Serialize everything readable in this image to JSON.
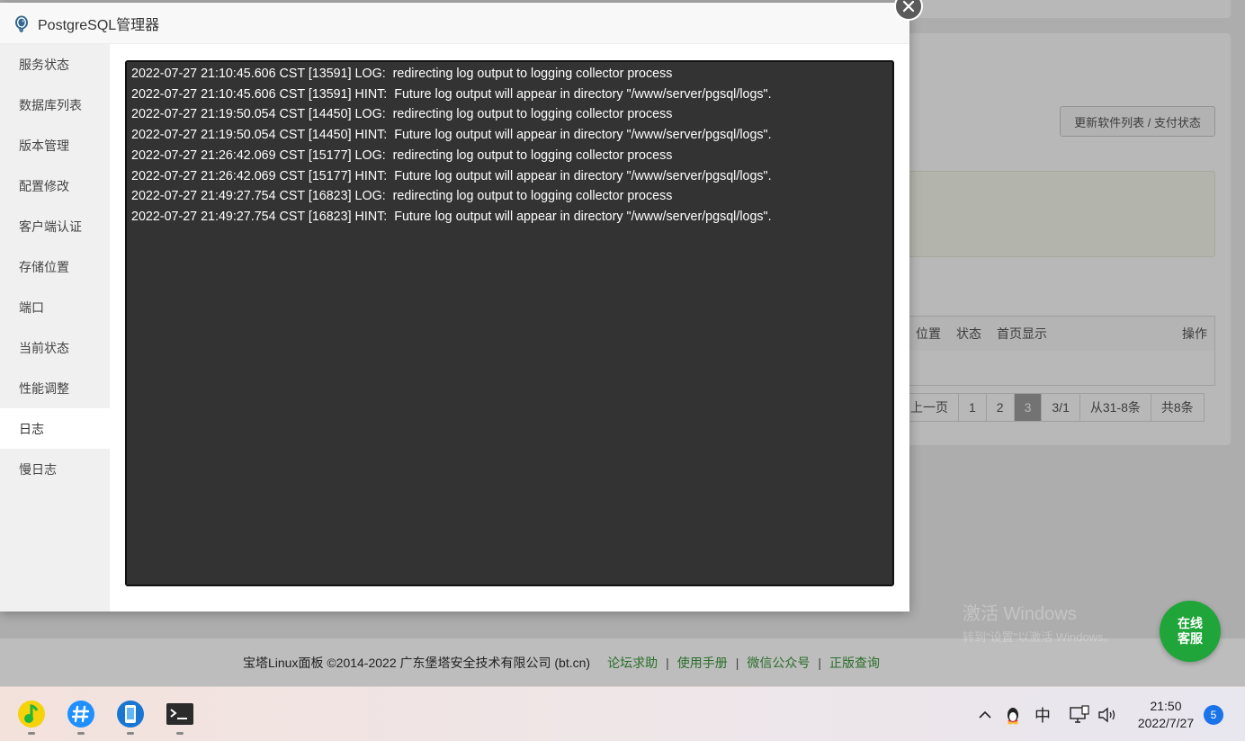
{
  "background": {
    "update_button": "更新软件列表 / 支付状态",
    "table_headers": [
      "位置",
      "状态",
      "首页显示"
    ],
    "table_ops": "操作",
    "pager": [
      "上一页",
      "1",
      "2",
      "3",
      "3/1",
      "从31-8条",
      "共8条"
    ],
    "pager_active_index": 3
  },
  "footer": {
    "copyright": "宝塔Linux面板 ©2014-2022 广东堡塔安全技术有限公司 (bt.cn)",
    "links": [
      "论坛求助",
      "使用手册",
      "微信公众号",
      "正版查询"
    ],
    "separator": "|"
  },
  "watermark": {
    "line1": "激活 Windows",
    "line2": "转到\"设置\"以激活 Windows。"
  },
  "support": {
    "line1": "在线",
    "line2": "客服"
  },
  "modal": {
    "title": "PostgreSQL管理器",
    "sidebar": [
      "服务状态",
      "数据库列表",
      "版本管理",
      "配置修改",
      "客户端认证",
      "存储位置",
      "端口",
      "当前状态",
      "性能调整",
      "日志",
      "慢日志"
    ],
    "active_index": 9,
    "log_lines": [
      "2022-07-27 21:10:45.606 CST [13591] LOG:  redirecting log output to logging collector process",
      "2022-07-27 21:10:45.606 CST [13591] HINT:  Future log output will appear in directory \"/www/server/pgsql/logs\".",
      "2022-07-27 21:19:50.054 CST [14450] LOG:  redirecting log output to logging collector process",
      "2022-07-27 21:19:50.054 CST [14450] HINT:  Future log output will appear in directory \"/www/server/pgsql/logs\".",
      "2022-07-27 21:26:42.069 CST [15177] LOG:  redirecting log output to logging collector process",
      "2022-07-27 21:26:42.069 CST [15177] HINT:  Future log output will appear in directory \"/www/server/pgsql/logs\".",
      "2022-07-27 21:49:27.754 CST [16823] LOG:  redirecting log output to logging collector process",
      "2022-07-27 21:49:27.754 CST [16823] HINT:  Future log output will appear in directory \"/www/server/pgsql/logs\"."
    ]
  },
  "taskbar": {
    "apps": [
      "music-app-icon",
      "hash-app-icon",
      "phone-app-icon",
      "terminal-app-icon"
    ],
    "ime": "中",
    "time": "21:50",
    "date": "2022/7/27",
    "notifications": "5"
  },
  "colors": {
    "accent": "#20a53a",
    "log_bg": "#333333",
    "link": "#2a6e2a"
  }
}
